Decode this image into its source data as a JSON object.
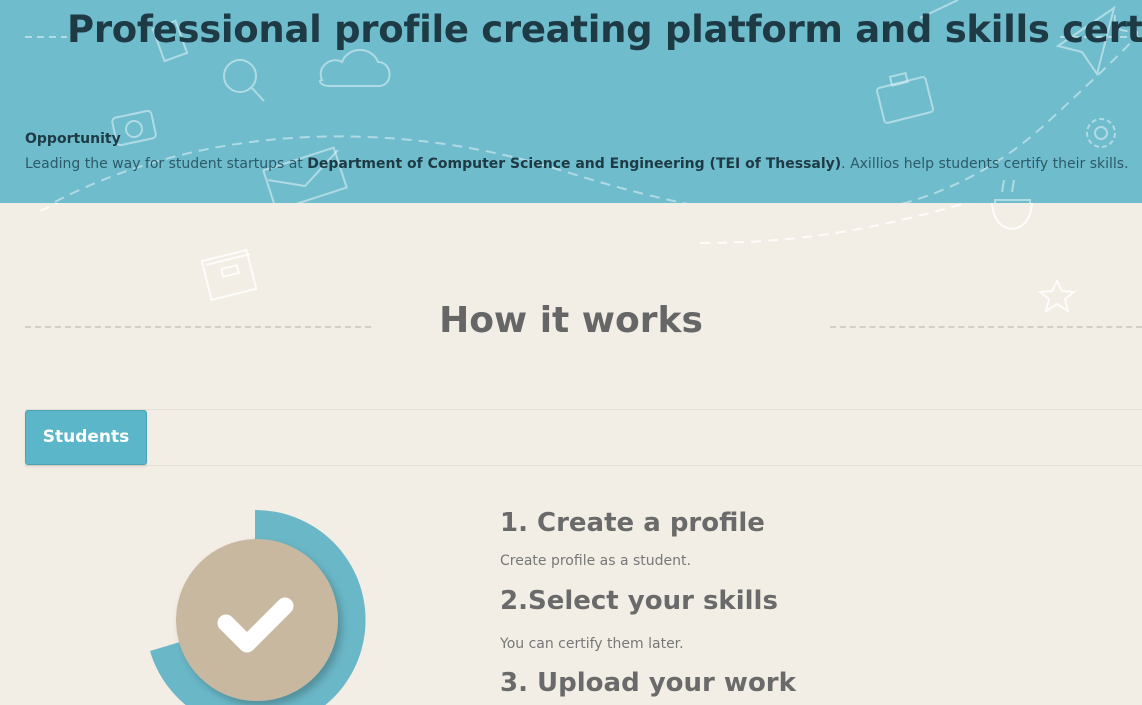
{
  "hero": {
    "title": "Professional profile creating platform and skills certification",
    "opportunity_label": "Opportunity",
    "opportunity_text_before": "Leading the way for student startups at ",
    "opportunity_text_bold": "Department of Computer Science and Engineering (TEI of Thessaly)",
    "opportunity_text_after": ". Axillios help students certify their skills."
  },
  "how": {
    "title": "How it works"
  },
  "tabs": [
    {
      "label": "Students"
    }
  ],
  "steps": [
    {
      "title": "1. Create a profile",
      "desc": "Create profile as a student."
    },
    {
      "title": "2.Select your skills",
      "desc": "You can certify them later."
    },
    {
      "title": "3. Upload your work",
      "desc": ""
    }
  ],
  "colors": {
    "hero_bg": "#6fbccc",
    "accent": "#5ab6c8",
    "circle": "#c9b8a0",
    "page_bg": "#f2eee6"
  },
  "icons": [
    "magnifier-icon",
    "cloud-icon",
    "camera-icon",
    "envelope-icon",
    "briefcase-icon",
    "gear-icon",
    "paper-plane-icon",
    "coffee-cup-icon",
    "box-icon",
    "star-icon",
    "checkmark-icon"
  ]
}
